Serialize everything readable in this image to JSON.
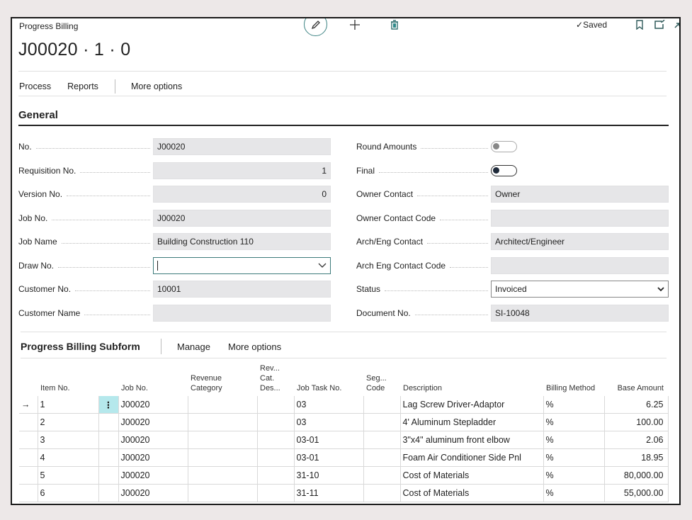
{
  "header": {
    "caption": "Progress Billing",
    "title": "J00020 · 1 · 0",
    "saved_label": "Saved"
  },
  "icons": {
    "edit": "pencil-icon",
    "new": "plus-icon",
    "delete": "trash-icon",
    "bookmark": "bookmark-icon",
    "open_new": "open-in-new-window-icon",
    "expand": "expand-icon"
  },
  "actionbar": {
    "process": "Process",
    "reports": "Reports",
    "more_options": "More options"
  },
  "general": {
    "title": "General",
    "left_fields": [
      {
        "label": "No.",
        "value": "J00020"
      },
      {
        "label": "Requisition No.",
        "value": "1"
      },
      {
        "label": "Version No.",
        "value": "0"
      },
      {
        "label": "Job No.",
        "value": "J00020"
      },
      {
        "label": "Job Name",
        "value": "Building Construction 110"
      },
      {
        "label": "Draw No.",
        "value": ""
      },
      {
        "label": "Customer No.",
        "value": "10001"
      },
      {
        "label": "Customer Name",
        "value": ""
      }
    ],
    "right_fields": [
      {
        "label": "Round Amounts",
        "value": "off"
      },
      {
        "label": "Final",
        "value": "off"
      },
      {
        "label": "Owner Contact",
        "value": "Owner"
      },
      {
        "label": "Owner Contact Code",
        "value": ""
      },
      {
        "label": "Arch/Eng Contact",
        "value": "Architect/Engineer"
      },
      {
        "label": "Arch Eng Contact Code",
        "value": ""
      },
      {
        "label": "Status",
        "value": "Invoiced"
      },
      {
        "label": "Document No.",
        "value": "SI-10048"
      }
    ]
  },
  "subform": {
    "title": "Progress Billing Subform",
    "manage": "Manage",
    "more_options": "More options",
    "columns": [
      "Item No.",
      "Job No.",
      "Revenue Category",
      "Rev... Cat. Des...",
      "Job Task No.",
      "Seg... Code",
      "Description",
      "Billing Method",
      "Base Amount"
    ],
    "rows": [
      {
        "item": "1",
        "job": "J00020",
        "rev_cat": "",
        "rev_desc": "",
        "task": "03",
        "seg": "",
        "desc": "Lag Screw Driver-Adaptor",
        "method": "%",
        "amount": "6.25"
      },
      {
        "item": "2",
        "job": "J00020",
        "rev_cat": "",
        "rev_desc": "",
        "task": "03",
        "seg": "",
        "desc": "4' Aluminum Stepladder",
        "method": "%",
        "amount": "100.00"
      },
      {
        "item": "3",
        "job": "J00020",
        "rev_cat": "",
        "rev_desc": "",
        "task": "03-01",
        "seg": "",
        "desc": "3\"x4\" aluminum front elbow",
        "method": "%",
        "amount": "2.06"
      },
      {
        "item": "4",
        "job": "J00020",
        "rev_cat": "",
        "rev_desc": "",
        "task": "03-01",
        "seg": "",
        "desc": "Foam Air Conditioner Side Pnl",
        "method": "%",
        "amount": "18.95"
      },
      {
        "item": "5",
        "job": "J00020",
        "rev_cat": "",
        "rev_desc": "",
        "task": "31-10",
        "seg": "",
        "desc": "Cost of Materials",
        "method": "%",
        "amount": "80,000.00"
      },
      {
        "item": "6",
        "job": "J00020",
        "rev_cat": "",
        "rev_desc": "",
        "task": "31-11",
        "seg": "",
        "desc": "Cost of Materials",
        "method": "%",
        "amount": "55,000.00"
      }
    ]
  }
}
